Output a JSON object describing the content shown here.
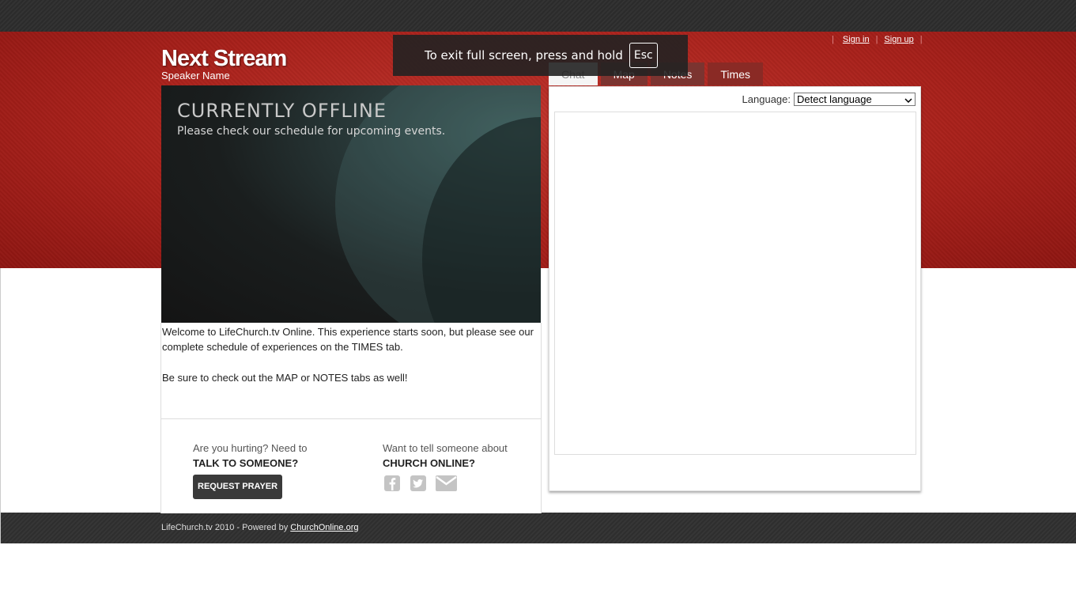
{
  "header": {
    "title": "Next Stream",
    "speaker": "Speaker Name"
  },
  "fullscreen_notice": {
    "text": "To exit full screen, press and hold",
    "key": "Esc"
  },
  "auth": {
    "sign_in": "Sign in",
    "sign_up": "Sign up"
  },
  "tabs": [
    {
      "label": "Chat",
      "active": true
    },
    {
      "label": "Map"
    },
    {
      "label": "Notes"
    },
    {
      "label": "Times"
    }
  ],
  "video": {
    "title": "CURRENTLY OFFLINE",
    "subtitle": "Please check our schedule for upcoming events."
  },
  "welcome": {
    "paragraph1": "Welcome to LifeChurch.tv Online. This experience starts soon, but please see our complete schedule of experiences on the TIMES tab.",
    "paragraph2": "Be sure to check out the MAP or NOTES tabs as well!"
  },
  "prayer": {
    "intro": "Are you hurting? Need to",
    "heading": "TALK TO SOMEONE?",
    "button": "REQUEST PRAYER"
  },
  "share": {
    "intro": "Want to tell someone about",
    "heading": "CHURCH ONLINE?",
    "icons": [
      "facebook-icon",
      "twitter-icon",
      "envelope-icon"
    ]
  },
  "chat": {
    "language_label": "Language:",
    "language_value": "Detect language"
  },
  "footer": {
    "copyright": "LifeChurch.tv 2010 - Powered by",
    "link": "ChurchOnline.org"
  },
  "colors": {
    "brand_red": "#a9211b",
    "dark_bar": "#2e2e2e"
  }
}
